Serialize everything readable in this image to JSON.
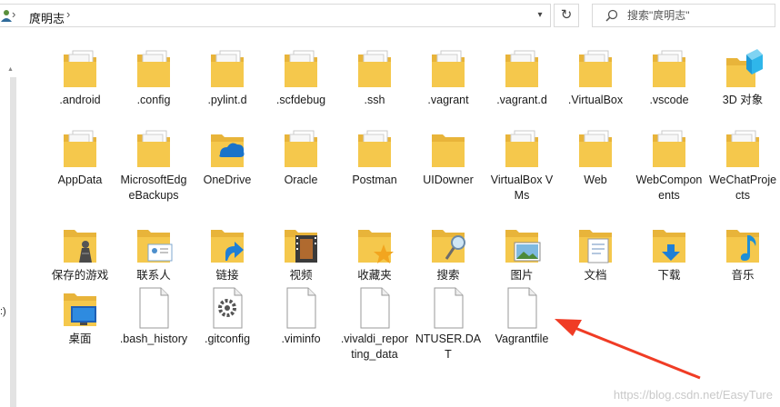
{
  "address": {
    "path": "庹明志",
    "separator": "›"
  },
  "search": {
    "placeholder": "搜索\"庹明志\""
  },
  "leftpane": {
    "fragment": ":)"
  },
  "items": [
    {
      "label": ".android",
      "icon": "folder-docs-icon"
    },
    {
      "label": ".config",
      "icon": "folder-vscode-icon"
    },
    {
      "label": ".pylint.d",
      "icon": "folder-docs-icon"
    },
    {
      "label": ".scfdebug",
      "icon": "folder-json-icon"
    },
    {
      "label": ".ssh",
      "icon": "folder-vscode-icon"
    },
    {
      "label": ".vagrant",
      "icon": "folder-docs-icon"
    },
    {
      "label": ".vagrant.d",
      "icon": "folder-docs-icon"
    },
    {
      "label": ".VirtualBox",
      "icon": "folder-vscode-icon"
    },
    {
      "label": ".vscode",
      "icon": "folder-json-icon"
    },
    {
      "label": "3D 对象",
      "icon": "folder-3d-icon"
    },
    {
      "label": "AppData",
      "icon": "folder-docs-icon"
    },
    {
      "label": "MicrosoftEdgeBackups",
      "icon": "folder-docs-icon"
    },
    {
      "label": "OneDrive",
      "icon": "onedrive-folder-icon"
    },
    {
      "label": "Oracle",
      "icon": "folder-docs-icon"
    },
    {
      "label": "Postman",
      "icon": "folder-docs-icon"
    },
    {
      "label": "UIDowner",
      "icon": "folder-empty-icon"
    },
    {
      "label": "VirtualBox VMs",
      "icon": "folder-docs-icon"
    },
    {
      "label": "Web",
      "icon": "folder-docs-icon"
    },
    {
      "label": "WebComponents",
      "icon": "folder-web-icon"
    },
    {
      "label": "WeChatProjects",
      "icon": "folder-docs-icon"
    },
    {
      "label": "保存的游戏",
      "icon": "saved-games-folder-icon"
    },
    {
      "label": "联系人",
      "icon": "contacts-folder-icon"
    },
    {
      "label": "链接",
      "icon": "links-folder-icon"
    },
    {
      "label": "视频",
      "icon": "videos-folder-icon"
    },
    {
      "label": "收藏夹",
      "icon": "favorites-folder-icon"
    },
    {
      "label": "搜索",
      "icon": "searches-folder-icon"
    },
    {
      "label": "图片",
      "icon": "pictures-folder-icon"
    },
    {
      "label": "文档",
      "icon": "documents-folder-icon"
    },
    {
      "label": "下载",
      "icon": "downloads-folder-icon"
    },
    {
      "label": "音乐",
      "icon": "music-folder-icon"
    },
    {
      "label": "桌面",
      "icon": "desktop-folder-icon"
    },
    {
      "label": ".bash_history",
      "icon": "file-icon"
    },
    {
      "label": ".gitconfig",
      "icon": "config-file-icon"
    },
    {
      "label": ".viminfo",
      "icon": "file-icon"
    },
    {
      "label": ".vivaldi_reporting_data",
      "icon": "file-icon"
    },
    {
      "label": "NTUSER.DAT",
      "icon": "file-icon"
    },
    {
      "label": "Vagrantfile",
      "icon": "file-icon"
    }
  ],
  "watermark": "https://blog.csdn.net/EasyTure",
  "colors": {
    "folder": "#f5c84c",
    "folder_back": "#e8b43a",
    "arrow": "#f03c25"
  }
}
